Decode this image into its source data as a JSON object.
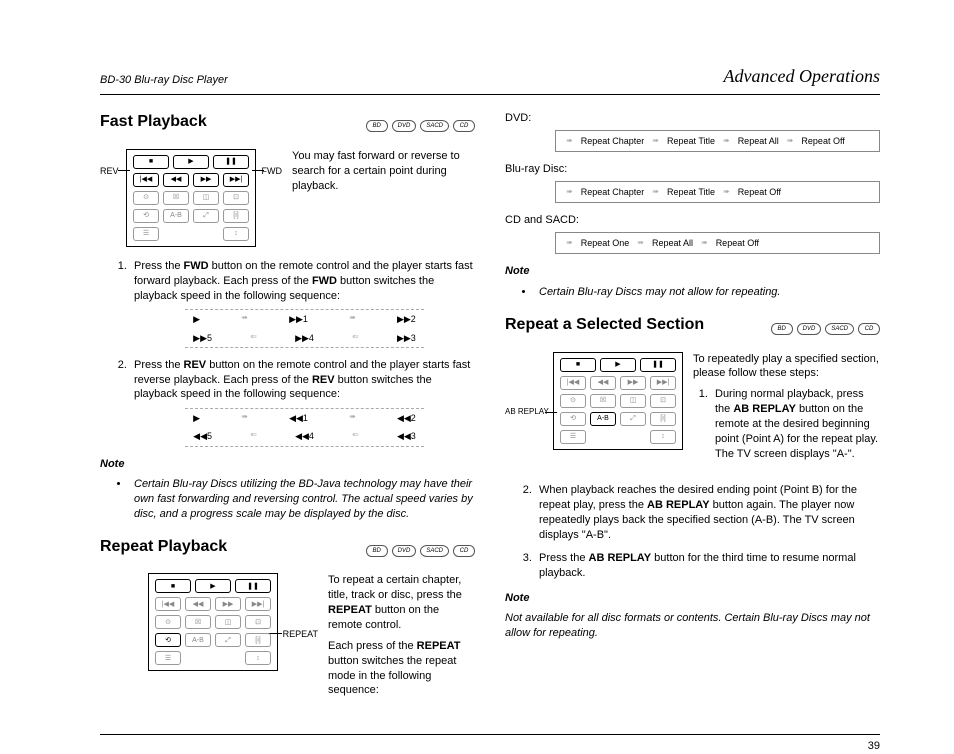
{
  "header": {
    "left": "BD-30 Blu-ray Disc Player",
    "right": "Advanced Operations"
  },
  "badges": {
    "bd": "BD",
    "dvd": "DVD",
    "sacd": "SACD",
    "cd": "CD"
  },
  "page_number": "39",
  "fast": {
    "title": "Fast Playback",
    "intro": "You may fast forward or reverse to search for a certain point during playback.",
    "rev_label": "REV",
    "fwd_label": "FWD",
    "step1_a": "Press the ",
    "step1_b": "FWD",
    "step1_c": " button on the remote control and the player starts fast forward playback. Each press of the ",
    "step1_d": "FWD",
    "step1_e": " button switches the playback speed in the following sequence:",
    "seq1_items": [
      "▶",
      "▶▶1",
      "▶▶2",
      "▶▶5",
      "▶▶4",
      "▶▶3"
    ],
    "step2_a": "Press the ",
    "step2_b": "REV",
    "step2_c": " button on the remote control and the player starts fast reverse playback. Each press of the ",
    "step2_d": "REV",
    "step2_e": " button switches the playback speed in the following sequence:",
    "seq2_items": [
      "▶",
      "◀◀1",
      "◀◀2",
      "◀◀5",
      "◀◀4",
      "◀◀3"
    ],
    "note_h": "Note",
    "note": "Certain Blu-ray Discs utilizing the BD-Java technology may have their own fast forwarding and reversing control. The actual speed varies by disc, and a progress scale may be displayed by the disc."
  },
  "repeat": {
    "title": "Repeat Playback",
    "label": "REPEAT",
    "intro1_a": "To repeat a certain chapter, title, track or disc, press the ",
    "intro1_b": "REPEAT",
    "intro1_c": " button on the remote control.",
    "intro2_a": "Each press of the ",
    "intro2_b": "REPEAT",
    "intro2_c": " button switches the repeat mode in the following sequence:",
    "dvd_label": "DVD:",
    "dvd_seq": [
      "Repeat Chapter",
      "Repeat Title",
      "Repeat All",
      "Repeat Off"
    ],
    "bd_label": "Blu-ray Disc:",
    "bd_seq": [
      "Repeat Chapter",
      "Repeat Title",
      "Repeat Off"
    ],
    "cd_label": "CD and SACD:",
    "cd_seq": [
      "Repeat One",
      "Repeat All",
      "Repeat Off"
    ],
    "note_h": "Note",
    "note": "Certain Blu-ray Discs may not allow for repeating."
  },
  "section": {
    "title": "Repeat a Selected Section",
    "label": "AB REPLAY",
    "intro": "To repeatedly play a specified section, please follow these steps:",
    "step1_a": "During normal playback, press the ",
    "step1_b": "AB REPLAY",
    "step1_c": " button on the remote at the desired beginning point (Point A) for the repeat play. The TV screen displays \"A-\".",
    "step2_a": "When playback reaches the desired ending point (Point B) for the repeat play, press the ",
    "step2_b": "AB REPLAY",
    "step2_c": " button again. The player now repeatedly plays back the specified section (A-B). The TV screen displays \"A-B\".",
    "step3_a": "Press the ",
    "step3_b": "AB REPLAY",
    "step3_c": " button for the third time to resume normal playback.",
    "note_h": "Note",
    "note": "Not available for all disc formats or contents. Certain Blu-ray Discs may not allow for repeating."
  }
}
